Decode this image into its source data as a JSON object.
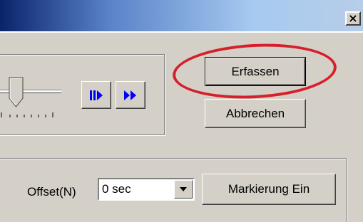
{
  "window": {
    "close_symbol": "×"
  },
  "capture": {
    "erfassen_label": "Erfassen",
    "abbrechen_label": "Abbrechen"
  },
  "playback": {
    "step_icon": "step-forward-icon",
    "fast_forward_icon": "fast-forward-icon",
    "icon_color": "#0000ff"
  },
  "offset": {
    "label": "Offset(N)",
    "value": "0 sec"
  },
  "marker": {
    "button_label": "Markierung Ein"
  },
  "annotation": {
    "highlight_color": "#d61f2a"
  }
}
